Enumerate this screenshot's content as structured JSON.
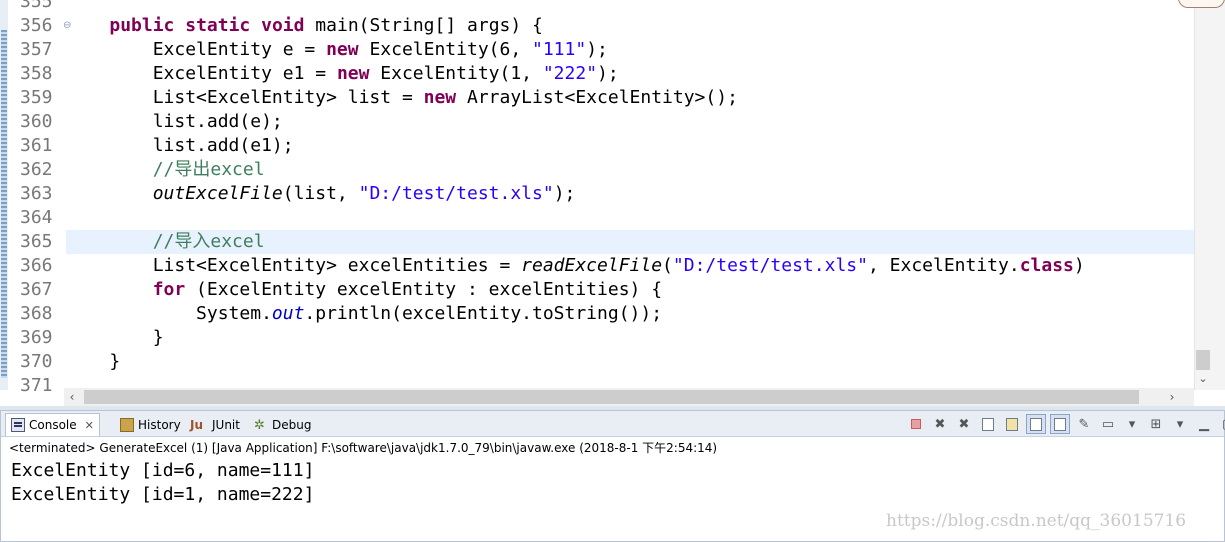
{
  "editor": {
    "lines": [
      {
        "no": "355",
        "segs": []
      },
      {
        "no": "356",
        "fold": true,
        "segs": [
          [
            "",
            "    "
          ],
          [
            "kw",
            "public"
          ],
          [
            "",
            " "
          ],
          [
            "kw",
            "static"
          ],
          [
            "",
            " "
          ],
          [
            "kw",
            "void"
          ],
          [
            "",
            " main(String[] args) {"
          ]
        ]
      },
      {
        "no": "357",
        "segs": [
          [
            "",
            "        ExcelEntity e = "
          ],
          [
            "kw",
            "new"
          ],
          [
            "",
            " ExcelEntity(6, "
          ],
          [
            "str",
            "\"111\""
          ],
          [
            "",
            ");"
          ]
        ]
      },
      {
        "no": "358",
        "segs": [
          [
            "",
            "        ExcelEntity e1 = "
          ],
          [
            "kw",
            "new"
          ],
          [
            "",
            " ExcelEntity(1, "
          ],
          [
            "str",
            "\"222\""
          ],
          [
            "",
            ");"
          ]
        ]
      },
      {
        "no": "359",
        "segs": [
          [
            "",
            "        List<ExcelEntity> list = "
          ],
          [
            "kw",
            "new"
          ],
          [
            "",
            " ArrayList<ExcelEntity>();"
          ]
        ]
      },
      {
        "no": "360",
        "segs": [
          [
            "",
            "        list.add(e);"
          ]
        ]
      },
      {
        "no": "361",
        "segs": [
          [
            "",
            "        list.add(e1);"
          ]
        ]
      },
      {
        "no": "362",
        "segs": [
          [
            "",
            "        "
          ],
          [
            "cmt",
            "//导出excel"
          ]
        ]
      },
      {
        "no": "363",
        "segs": [
          [
            "",
            "        "
          ],
          [
            "it",
            "outExcelFile"
          ],
          [
            "",
            "(list, "
          ],
          [
            "str",
            "\"D:/test/test.xls\""
          ],
          [
            "",
            ");"
          ]
        ]
      },
      {
        "no": "364",
        "segs": []
      },
      {
        "no": "365",
        "current": true,
        "segs": [
          [
            "",
            "        "
          ],
          [
            "cmt",
            "//导入excel"
          ]
        ]
      },
      {
        "no": "366",
        "segs": [
          [
            "",
            "        List<ExcelEntity> excelEntities = "
          ],
          [
            "it",
            "readExcelFile"
          ],
          [
            "",
            "("
          ],
          [
            "str",
            "\"D:/test/test.xls\""
          ],
          [
            "",
            ", ExcelEntity."
          ],
          [
            "kw",
            "class"
          ],
          [
            "",
            ")"
          ]
        ]
      },
      {
        "no": "367",
        "segs": [
          [
            "",
            "        "
          ],
          [
            "kw",
            "for"
          ],
          [
            "",
            " (ExcelEntity excelEntity : excelEntities) {"
          ]
        ]
      },
      {
        "no": "368",
        "segs": [
          [
            "",
            "            System."
          ],
          [
            "fld",
            "out"
          ],
          [
            "",
            ".println(excelEntity.toString());"
          ]
        ]
      },
      {
        "no": "369",
        "segs": [
          [
            "",
            "        }"
          ]
        ]
      },
      {
        "no": "370",
        "segs": [
          [
            "",
            "    }"
          ]
        ]
      },
      {
        "no": "371",
        "segs": []
      }
    ]
  },
  "console": {
    "tabs": [
      {
        "name": "tab-console",
        "icon": "console-icon",
        "label": "Console",
        "active": true,
        "closable": true
      },
      {
        "name": "tab-history",
        "icon": "history-icon",
        "label": "History"
      },
      {
        "name": "tab-junit",
        "icon": "junit-icon",
        "prefix": "Ju",
        "label": "JUnit"
      },
      {
        "name": "tab-debug",
        "icon": "debug-icon",
        "prefix": "✲",
        "label": "Debug"
      }
    ],
    "close_glyph": "✕",
    "status": "<terminated> GenerateExcel (1) [Java Application] F:\\software\\java\\jdk1.7.0_79\\bin\\javaw.exe (2018-8-1 下午2:54:14)",
    "output": [
      "ExcelEntity [id=6, name=111]",
      "ExcelEntity [id=1, name=222]"
    ]
  },
  "scrollbars": {
    "left_arrow": "‹",
    "right_arrow": "›",
    "down_arrow": "⌄"
  },
  "watermark": "https://blog.csdn.net/qq_36015716"
}
